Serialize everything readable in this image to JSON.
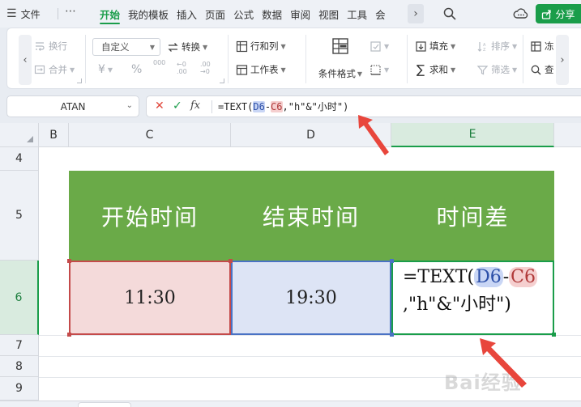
{
  "menubar": {
    "file_label": "文件",
    "more_label": "⋯",
    "tabs": [
      {
        "label": "开始",
        "active": true
      },
      {
        "label": "我的模板",
        "active": false
      },
      {
        "label": "插入",
        "active": false
      },
      {
        "label": "页面",
        "active": false
      },
      {
        "label": "公式",
        "active": false
      },
      {
        "label": "数据",
        "active": false
      },
      {
        "label": "审阅",
        "active": false
      },
      {
        "label": "视图",
        "active": false
      },
      {
        "label": "工具",
        "active": false
      },
      {
        "label": "会",
        "active": false
      }
    ],
    "share_label": "分享"
  },
  "ribbon": {
    "wrap_label": "换行",
    "merge_label": "合并",
    "number_format": "自定义",
    "convert_label": "转换",
    "currency_symbol": "¥",
    "percent_symbol": "%",
    "thousands_symbol": "000",
    "dec_inc_symbol": "←0 .00",
    "dec_dec_symbol": ".00 →0",
    "rowcol_label": "行和列",
    "worksheet_label": "工作表",
    "cond_format_label": "条件格式",
    "fill_label": "填充",
    "sum_label": "求和",
    "sort_label": "排序",
    "filter_label": "筛选",
    "cut_label_1": "冻",
    "cut_label_2": "查"
  },
  "formula_bar": {
    "name_box": "ATAN",
    "prefix": "=TEXT(",
    "ref1": "D6",
    "minus": "-",
    "ref2": "C6",
    "suffix": ",\"h\"&\"小时\")"
  },
  "sheet": {
    "columns": [
      "B",
      "C",
      "D",
      "E"
    ],
    "rows": [
      "4",
      "5",
      "6",
      "7",
      "8",
      "9"
    ],
    "headers": [
      "开始时间",
      "结束时间",
      "时间差"
    ],
    "start_time": "11:30",
    "end_time": "19:30",
    "edit_line1_prefix": "=TEXT(",
    "edit_ref1": "D6",
    "edit_minus": "-",
    "edit_ref2": "C6",
    "edit_line2": ",\"h\"&\"小时\")"
  },
  "watermark_text": "Bai经验",
  "colors": {
    "accent_green": "#1a9d4a",
    "header_green": "#6aaa48",
    "ref_red": "#c44a4a",
    "ref_blue": "#4a72c4",
    "arrow_red": "#e8463c"
  }
}
